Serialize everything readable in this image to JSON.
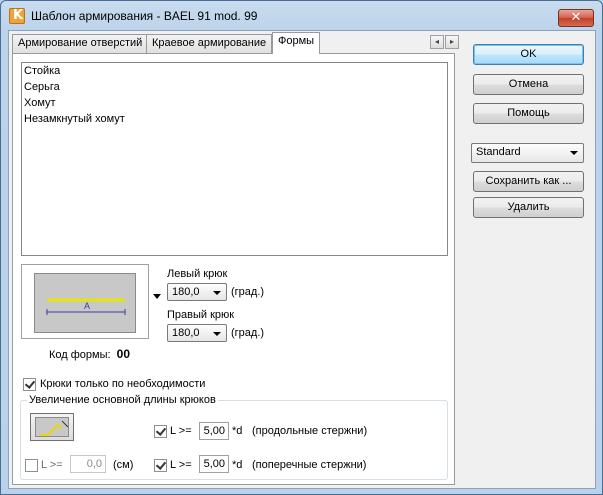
{
  "window": {
    "title": "Шаблон армирования - BAEL 91 mod. 99",
    "app_icon": "K",
    "close_symbol": "✕"
  },
  "tabs": [
    {
      "label": "Армирование отверстий",
      "active": false
    },
    {
      "label": "Краевое армирование",
      "active": false
    },
    {
      "label": "Формы",
      "active": true
    }
  ],
  "tab_scroll": {
    "left": "◂",
    "right": "▸"
  },
  "shapes": [
    "Стойка",
    "Серьга",
    "Хомут",
    "Незамкнутый хомут"
  ],
  "preview": {
    "dimension_label": "A"
  },
  "form_code": {
    "label": "Код формы:",
    "value": "00"
  },
  "left_hook": {
    "label": "Левый крюк",
    "value": "180,0",
    "unit": "(град.)"
  },
  "right_hook": {
    "label": "Правый крюк",
    "value": "180,0",
    "unit": "(град.)"
  },
  "hooks_only_needed": {
    "label": "Крюки только по необходимости",
    "checked": true
  },
  "hook_extension": {
    "title": "Увеличение основной длины крюков",
    "length_check": {
      "label": "L >=",
      "value": "0,0",
      "unit": "(см)",
      "checked": false
    },
    "longitudinal": {
      "label": "L >=",
      "value": "5,00",
      "unit": "*d",
      "note": "(продольные стержни)",
      "checked": true
    },
    "transverse": {
      "label": "L >=",
      "value": "5,00",
      "unit": "*d",
      "note": "(поперечные стержни)",
      "checked": true
    }
  },
  "buttons": {
    "ok": "OK",
    "cancel": "Отмена",
    "help": "Помощь",
    "standard": "Standard",
    "save_as": "Сохранить как ...",
    "delete": "Удалить"
  },
  "colors": {
    "preview_bar": "#e6e600",
    "preview_dim": "#3a3aa0",
    "hook_shape": "#e6d800"
  }
}
